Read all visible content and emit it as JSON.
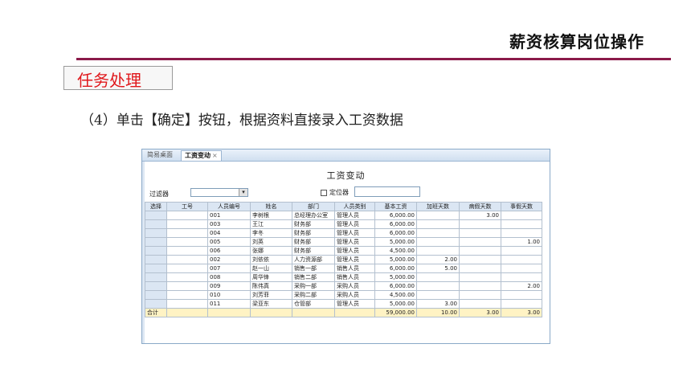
{
  "header": {
    "title": "薪资核算岗位操作"
  },
  "task": {
    "label": "任务处理"
  },
  "instruction": "（4）单击【确定】按钮，根据资料直接录入工资数据",
  "app": {
    "tabs": [
      {
        "label": "简易桌面"
      },
      {
        "label": "工资变动",
        "close": "×"
      }
    ],
    "form_title": "工资变动",
    "filter_label": "过滤器",
    "filter_value": "",
    "filter_arrow": "▾",
    "locate_label": "定位器",
    "table": {
      "headers": [
        "选择",
        "工号",
        "人员编号",
        "姓名",
        "部门",
        "人员类别",
        "基本工资",
        "加班天数",
        "病假天数",
        "事假天数"
      ],
      "rows": [
        [
          "",
          "",
          "001",
          "李树根",
          "总经理办公室",
          "管理人员",
          "6,000.00",
          "",
          "3.00",
          ""
        ],
        [
          "",
          "",
          "003",
          "王江",
          "财务部",
          "管理人员",
          "6,000.00",
          "",
          "",
          ""
        ],
        [
          "",
          "",
          "004",
          "李冬",
          "财务部",
          "管理人员",
          "6,000.00",
          "",
          "",
          ""
        ],
        [
          "",
          "",
          "005",
          "刘英",
          "财务部",
          "管理人员",
          "5,000.00",
          "",
          "",
          "1.00"
        ],
        [
          "",
          "",
          "006",
          "张娜",
          "财务部",
          "管理人员",
          "4,500.00",
          "",
          "",
          ""
        ],
        [
          "",
          "",
          "002",
          "刘依依",
          "人力资源部",
          "管理人员",
          "5,000.00",
          "2.00",
          "",
          ""
        ],
        [
          "",
          "",
          "007",
          "赵一山",
          "销售一部",
          "销售人员",
          "6,000.00",
          "5.00",
          "",
          ""
        ],
        [
          "",
          "",
          "008",
          "周华锋",
          "销售二部",
          "销售人员",
          "5,000.00",
          "",
          "",
          ""
        ],
        [
          "",
          "",
          "009",
          "陈伟真",
          "采购一部",
          "采购人员",
          "6,000.00",
          "",
          "",
          "2.00"
        ],
        [
          "",
          "",
          "010",
          "刘芳菲",
          "采购二部",
          "采购人员",
          "4,500.00",
          "",
          "",
          ""
        ],
        [
          "",
          "",
          "011",
          "梁亚东",
          "仓管部",
          "管理人员",
          "5,000.00",
          "3.00",
          "",
          ""
        ]
      ],
      "total": [
        "合计",
        "",
        "",
        "",
        "",
        "",
        "59,000.00",
        "10.00",
        "3.00",
        "3.00"
      ]
    }
  }
}
